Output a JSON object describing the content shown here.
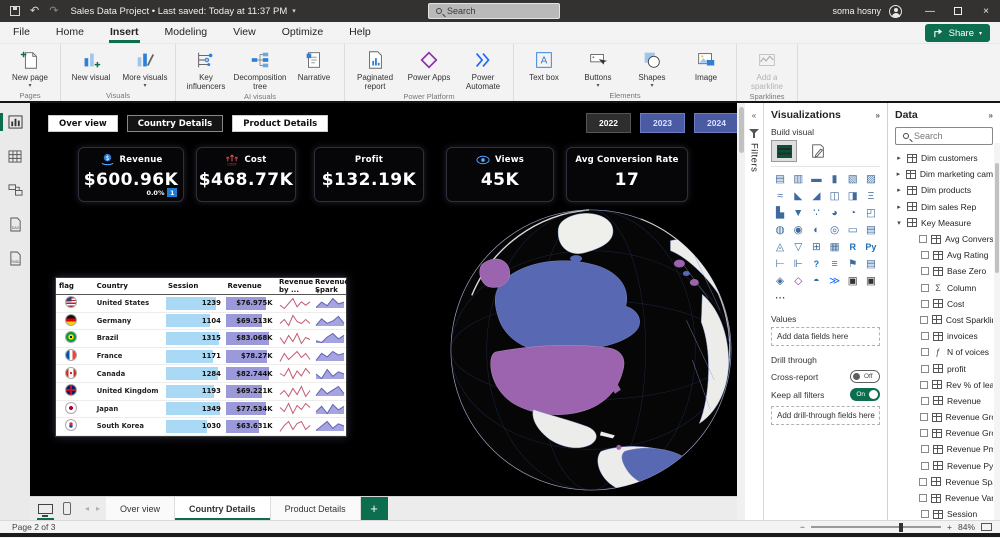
{
  "titlebar": {
    "title": "Sales Data Project  •  Last saved: Today at 11:37 PM",
    "search_placeholder": "Search",
    "user": "soma hosny"
  },
  "menubar": {
    "items": [
      "File",
      "Home",
      "Insert",
      "Modeling",
      "View",
      "Optimize",
      "Help"
    ],
    "active": "Insert",
    "share_label": "Share"
  },
  "ribbon": {
    "groups": [
      {
        "name": "Pages",
        "items": [
          {
            "label": "New page",
            "caret": true,
            "icon": "new-page"
          }
        ]
      },
      {
        "name": "Visuals",
        "items": [
          {
            "label": "New visual",
            "icon": "new-visual"
          },
          {
            "label": "More visuals",
            "caret": true,
            "icon": "more-visuals"
          }
        ]
      },
      {
        "name": "AI visuals",
        "items": [
          {
            "label": "Key influencers",
            "icon": "key-influencers"
          },
          {
            "label": "Decomposition tree",
            "icon": "decomposition-tree"
          },
          {
            "label": "Narrative",
            "icon": "narrative"
          }
        ]
      },
      {
        "name": "Power Platform",
        "items": [
          {
            "label": "Paginated report",
            "icon": "paginated-report"
          },
          {
            "label": "Power Apps",
            "icon": "power-apps"
          },
          {
            "label": "Power Automate",
            "icon": "power-automate"
          }
        ]
      },
      {
        "name": "Elements",
        "items": [
          {
            "label": "Text box",
            "icon": "text-box"
          },
          {
            "label": "Buttons",
            "caret": true,
            "icon": "buttons"
          },
          {
            "label": "Shapes",
            "caret": true,
            "icon": "shapes"
          },
          {
            "label": "Image",
            "icon": "image"
          }
        ]
      },
      {
        "name": "Sparklines",
        "items": [
          {
            "label": "Add a sparkline",
            "icon": "add-sparkline",
            "disabled": true
          }
        ]
      }
    ]
  },
  "sidebar": {
    "views": [
      "Report view",
      "Table view",
      "Model view",
      "DAX query view",
      "TMDL view"
    ],
    "active_index": 0
  },
  "dashboard": {
    "nav_buttons": [
      {
        "label": "Over view",
        "active": false
      },
      {
        "label": "Country Details",
        "active": true
      },
      {
        "label": "Product Details",
        "active": false
      }
    ],
    "year_buttons": [
      {
        "label": "2022",
        "active": false
      },
      {
        "label": "2023",
        "active": true
      },
      {
        "label": "2024",
        "active": true
      }
    ],
    "kpis": [
      {
        "title": "Revenue",
        "value": "$600.96K",
        "sub": "0.0%",
        "badge": "1",
        "icon": "revenue-coin-hand"
      },
      {
        "title": "Cost",
        "value": "$468.77K",
        "icon": "cost-arrows"
      },
      {
        "title": "Profit",
        "value": "$132.19K",
        "icon": "none"
      },
      {
        "title": "Views",
        "value": "45K",
        "icon": "eye"
      },
      {
        "title": "Avg Conversion Rate",
        "value": "17",
        "icon": "none"
      }
    ],
    "table": {
      "headers": [
        "flag",
        "Country",
        "Session",
        "Revenue",
        "Revenue by ...",
        "Revenue Spark"
      ],
      "session_max": 1400,
      "revenue_max": 90,
      "rows": [
        {
          "flag": "us",
          "country": "United States",
          "session": 1239,
          "revenue": "$76.975K",
          "revenue_value": 76.975,
          "trend": [
            5,
            3,
            6,
            9,
            4,
            7,
            5,
            7
          ],
          "spark": [
            2,
            5,
            3,
            7,
            4,
            5
          ]
        },
        {
          "flag": "de",
          "country": "Germany",
          "session": 1104,
          "revenue": "$69.513K",
          "revenue_value": 69.513,
          "trend": [
            4,
            6,
            3,
            8,
            5,
            4,
            6,
            4
          ],
          "spark": [
            3,
            6,
            4,
            5,
            7,
            4
          ]
        },
        {
          "flag": "br",
          "country": "Brazil",
          "session": 1315,
          "revenue": "$83.068K",
          "revenue_value": 83.068,
          "trend": [
            6,
            3,
            7,
            4,
            8,
            3,
            6,
            5
          ],
          "spark": [
            4,
            3,
            6,
            8,
            5,
            7
          ]
        },
        {
          "flag": "fr",
          "country": "France",
          "session": 1171,
          "revenue": "$78.27K",
          "revenue_value": 78.27,
          "trend": [
            3,
            7,
            4,
            6,
            8,
            5,
            7,
            4
          ],
          "spark": [
            2,
            6,
            4,
            7,
            5,
            6
          ]
        },
        {
          "flag": "ca",
          "country": "Canada",
          "session": 1284,
          "revenue": "$82.744K",
          "revenue_value": 82.744,
          "trend": [
            5,
            4,
            7,
            3,
            6,
            4,
            7,
            5
          ],
          "spark": [
            5,
            3,
            7,
            4,
            6,
            5
          ]
        },
        {
          "flag": "gb",
          "country": "United Kingdom",
          "session": 1193,
          "revenue": "$69.221K",
          "revenue_value": 69.221,
          "trend": [
            4,
            6,
            3,
            7,
            4,
            8,
            3,
            6
          ],
          "spark": [
            3,
            7,
            4,
            6,
            8,
            4
          ]
        },
        {
          "flag": "jp",
          "country": "Japan",
          "session": 1349,
          "revenue": "$77.534K",
          "revenue_value": 77.534,
          "trend": [
            6,
            4,
            8,
            3,
            7,
            5,
            8,
            6
          ],
          "spark": [
            4,
            7,
            3,
            8,
            5,
            7
          ]
        },
        {
          "flag": "kr",
          "country": "South Korea",
          "session": 1030,
          "revenue": "$63.631K",
          "revenue_value": 63.631,
          "trend": [
            3,
            6,
            8,
            4,
            7,
            8,
            4,
            6
          ],
          "spark": [
            3,
            5,
            7,
            4,
            6,
            5
          ]
        }
      ]
    }
  },
  "filters_panel": {
    "label": "Filters"
  },
  "viz_panel": {
    "title": "Visualizations",
    "build_visual_label": "Build visual",
    "icons": [
      "stacked-bar",
      "stacked-column",
      "clustered-bar",
      "clustered-column",
      "100-stacked-bar",
      "100-stacked-column",
      "line",
      "area",
      "stacked-area",
      "line-stacked-column",
      "line-clustered-column",
      "ribbon",
      "waterfall",
      "funnel",
      "scatter",
      "pie",
      "donut",
      "treemap",
      "map",
      "filled-map",
      "shape-map",
      "azure-map",
      "card",
      "multi-row-card",
      "kpi",
      "slicer",
      "table",
      "matrix",
      "r-script",
      "python",
      "key-influencers",
      "decomposition-tree",
      "qa",
      "smart-narrative",
      "metrics",
      "paginated-report",
      "arcgis",
      "power-apps",
      "gauge",
      "power-automate",
      "custom-visual",
      "custom-visual-2",
      "more-options"
    ],
    "values_label": "Values",
    "add_fields_placeholder": "Add data fields here",
    "drill_through_label": "Drill through",
    "cross_report_label": "Cross-report",
    "cross_report_state": "Off",
    "keep_filters_label": "Keep all filters",
    "keep_filters_state": "On",
    "add_drill_placeholder": "Add drill-through fields here"
  },
  "data_panel": {
    "title": "Data",
    "search_placeholder": "Search",
    "tables": [
      "Dim customers",
      "Dim marketing camp...",
      "Dim products",
      "Dim sales Rep"
    ],
    "measure_group": "Key Measure",
    "fields": [
      {
        "label": "Avg Conversio...",
        "icon": "calc"
      },
      {
        "label": "Avg Rating",
        "icon": "calc"
      },
      {
        "label": "Base Zero",
        "icon": "calc"
      },
      {
        "label": "Column",
        "icon": "sigma"
      },
      {
        "label": "Cost",
        "icon": "calc"
      },
      {
        "label": "Cost Sparkline",
        "icon": "calc"
      },
      {
        "label": "invoices",
        "icon": "calc"
      },
      {
        "label": "N of voices",
        "icon": "doc"
      },
      {
        "label": "profit",
        "icon": "calc"
      },
      {
        "label": "Rev % of lead",
        "icon": "calc"
      },
      {
        "label": "Revenue",
        "icon": "calc"
      },
      {
        "label": "Revenue Gro...",
        "icon": "calc"
      },
      {
        "label": "Revenue Gro...",
        "icon": "calc"
      },
      {
        "label": "Revenue Pm",
        "icon": "calc"
      },
      {
        "label": "Revenue Py",
        "icon": "calc"
      },
      {
        "label": "Revenue Spark",
        "icon": "calc"
      },
      {
        "label": "Revenue Varia...",
        "icon": "calc"
      },
      {
        "label": "Session",
        "icon": "calc"
      }
    ]
  },
  "pagebar": {
    "tabs": [
      "Over view",
      "Country Details",
      "Product Details"
    ],
    "active_index": 1
  },
  "statusbar": {
    "page_label": "Page 2 of 3",
    "zoom_label": "84%"
  },
  "colors": {
    "accent_green": "#0d6e4f",
    "year_blue": "#4a5ba3",
    "bar_blue": "#a9d9f5",
    "bar_purple": "#9b99d9",
    "trend_rose": "#c25b73",
    "spark_purple": "#6361b5",
    "map_blue": "#5868b3",
    "map_purple": "#9c64ae"
  }
}
